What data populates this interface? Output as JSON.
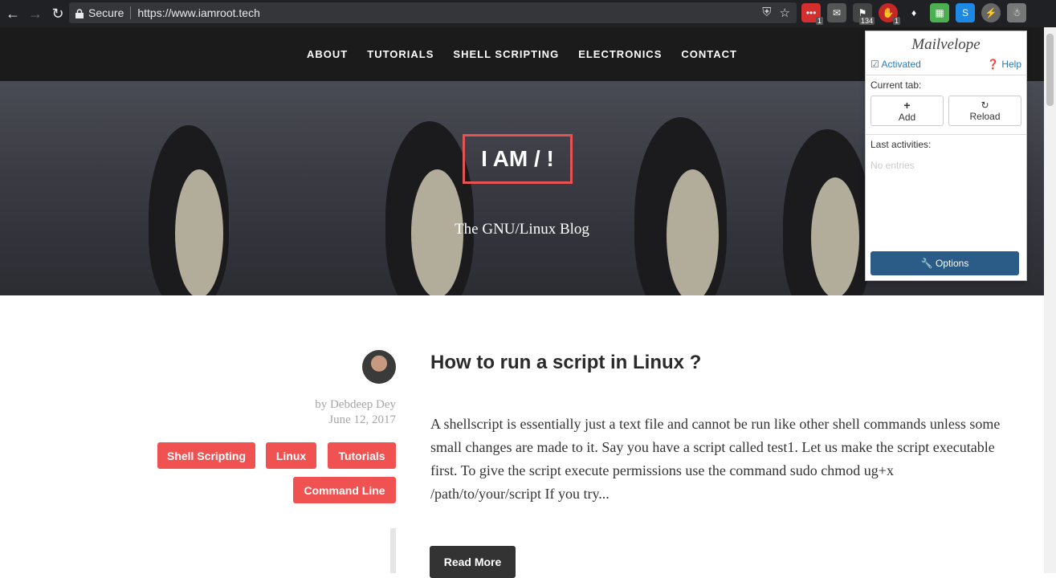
{
  "browser": {
    "secure_label": "Secure",
    "url": "https://www.iamroot.tech",
    "extensions": [
      {
        "name": "lastpass",
        "badge": "1"
      },
      {
        "name": "mail",
        "badge": ""
      },
      {
        "name": "ext-feed",
        "badge": "134"
      },
      {
        "name": "adblock",
        "badge": "1"
      },
      {
        "name": "diamond",
        "badge": ""
      },
      {
        "name": "green",
        "badge": ""
      },
      {
        "name": "s-ext",
        "badge": ""
      },
      {
        "name": "bolt",
        "badge": ""
      },
      {
        "name": "mailvelope",
        "badge": ""
      }
    ]
  },
  "site_nav": [
    "ABOUT",
    "TUTORIALS",
    "SHELL SCRIPTING",
    "ELECTRONICS",
    "CONTACT"
  ],
  "hero": {
    "brand": "I AM / !",
    "tagline": "The GNU/Linux Blog"
  },
  "post": {
    "author": "by Debdeep Dey",
    "date": "June 12, 2017",
    "tags": [
      "Shell Scripting",
      "Linux",
      "Tutorials",
      "Command Line"
    ],
    "title": "How to run a script in Linux ?",
    "excerpt": "A shellscript is essentially just a text file and cannot be run like other shell commands unless some small changes are made to it. Say you have a script called test1. Let us make the script executable first. To give the script execute permissions use the command sudo chmod ug+x /path/to/your/script If you try...",
    "read_more": "Read More"
  },
  "mailvelope": {
    "logo": "Mailvelope",
    "activated": "Activated",
    "help": "Help",
    "current_tab": "Current tab:",
    "add": "Add",
    "reload": "Reload",
    "last_activities": "Last activities:",
    "no_entries": "No entries",
    "options": "Options"
  }
}
